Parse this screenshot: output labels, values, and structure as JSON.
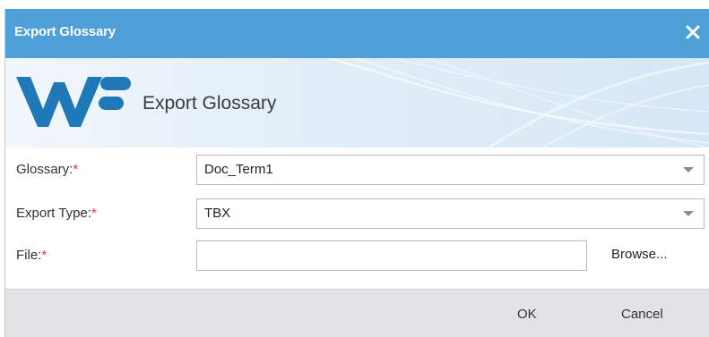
{
  "dialog": {
    "title": "Export Glossary",
    "close_icon": "close-icon",
    "banner": {
      "logo": "wordfast-logo",
      "title": "Export Glossary"
    }
  },
  "form": {
    "glossary": {
      "label": "Glossary:",
      "required_mark": "*",
      "value": "Doc_Term1",
      "icon": "chevron-down-icon"
    },
    "export_type": {
      "label": "Export Type:",
      "required_mark": "*",
      "value": "TBX",
      "icon": "chevron-down-icon"
    },
    "file": {
      "label": "File:",
      "required_mark": "*",
      "value": "",
      "browse_label": "Browse..."
    }
  },
  "footer": {
    "ok_label": "OK",
    "cancel_label": "Cancel"
  },
  "colors": {
    "titlebar": "#4fa0d9",
    "logo": "#1f78b8",
    "required": "#e23b3b",
    "footer": "#e3e3e6"
  }
}
